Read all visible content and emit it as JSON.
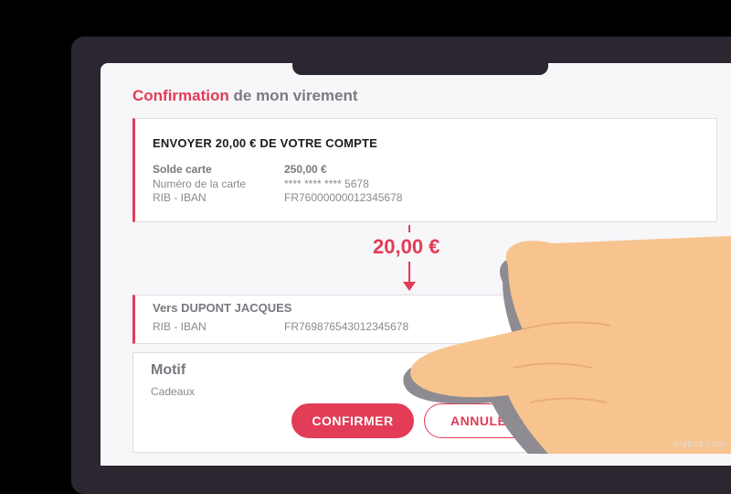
{
  "header": {
    "title_accent": "Confirmation",
    "title_rest": " de mon virement"
  },
  "source": {
    "heading": "ENVOYER 20,00 € DE VOTRE COMPTE",
    "rows": [
      {
        "label": "Solde carte",
        "value": "250,00 €"
      },
      {
        "label": "Numéro de la carte",
        "value": "**** **** **** 5678"
      },
      {
        "label": "RIB - IBAN",
        "value": "FR76000000012345678"
      }
    ]
  },
  "transfer": {
    "amount": "20,00 €"
  },
  "recipient": {
    "heading": "Vers DUPONT JACQUES",
    "row": {
      "label": "RIB - IBAN",
      "value": "FR769876543012345678"
    }
  },
  "motif": {
    "label": "Motif",
    "value": "Cadeaux"
  },
  "actions": {
    "confirm_label": "CONFIRMER",
    "cancel_label": "ANNULER"
  },
  "watermark": "mypcs.com",
  "colors": {
    "accent": "#e23c57",
    "device": "#2b2630",
    "hand": "#f7c48f"
  }
}
